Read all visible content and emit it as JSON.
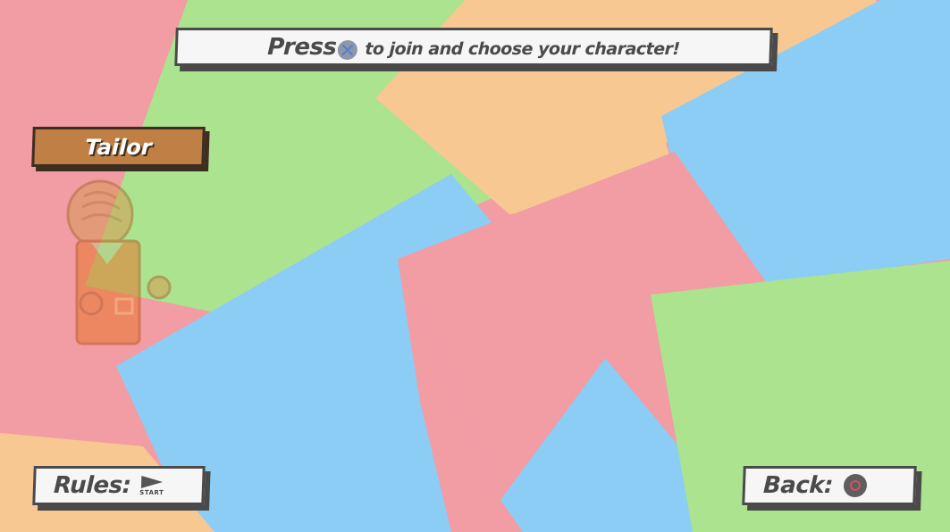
{
  "prompt": {
    "before_button": "Press",
    "button_icon": "cross-button-icon",
    "after_button": "to join and choose your character!"
  },
  "character": {
    "name": "Tailor",
    "colors": {
      "hair": "#d79a55",
      "body": "#e8762e",
      "collar": "#b8c98e",
      "tag": "#c07f45"
    }
  },
  "footer": {
    "rules_label": "Rules:",
    "rules_button_label": "START",
    "rules_button_icon": "start-button-icon",
    "back_label": "Back:",
    "back_button_icon": "circle-button-icon"
  },
  "background": {
    "colors": {
      "pink": "#f29ca3",
      "green": "#abe38e",
      "orange": "#f7c892",
      "blue": "#8ccdf6"
    }
  }
}
